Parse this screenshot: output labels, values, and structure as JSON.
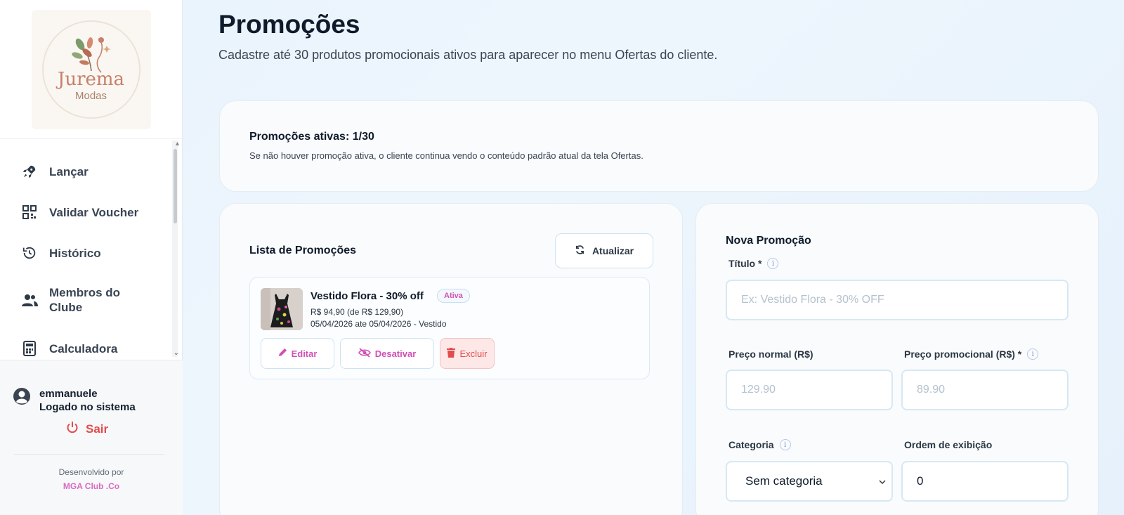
{
  "sidebar": {
    "logo": {
      "title": "Jurema",
      "subtitle": "Modas"
    },
    "items": [
      {
        "label": "Lançar",
        "icon": "rocket-icon"
      },
      {
        "label": "Validar Voucher",
        "icon": "qrcode-icon"
      },
      {
        "label": "Histórico",
        "icon": "history-icon"
      },
      {
        "label": "Membros do Clube",
        "icon": "users-icon"
      },
      {
        "label": "Calculadora",
        "icon": "calculator-icon"
      }
    ],
    "user": {
      "name": "emmanuele",
      "status": "Logado no sistema"
    },
    "logout_label": "Sair",
    "developed_by": "Desenvolvido por",
    "brand": "MGA Club .Co"
  },
  "header": {
    "title": "Promoções",
    "subtitle": "Cadastre até 30 produtos promocionais ativos para aparecer no menu Ofertas do cliente."
  },
  "status": {
    "title": "Promoções ativas: 1/30",
    "subtitle": "Se não houver promoção ativa, o cliente continua vendo o conteúdo padrão atual da tela Ofertas."
  },
  "list": {
    "title": "Lista de Promoções",
    "refresh_label": "Atualizar",
    "items": [
      {
        "name": "Vestido Flora - 30% off",
        "badge": "Ativa",
        "price": "R$ 94,90 (de R$ 129,90)",
        "dates": "05/04/2026 ate 05/04/2026 - Vestido",
        "edit_label": "Editar",
        "disable_label": "Desativar",
        "delete_label": "Excluir"
      }
    ]
  },
  "form": {
    "title": "Nova Promoção",
    "titulo_label": "Título *",
    "titulo_placeholder": "Ex: Vestido Flora - 30% OFF",
    "preco_normal_label": "Preço normal (R$)",
    "preco_normal_placeholder": "129.90",
    "preco_promo_label": "Preço promocional (R$) *",
    "preco_promo_placeholder": "89.90",
    "categoria_label": "Categoria",
    "categoria_value": "Sem categoria",
    "ordem_label": "Ordem de exibição",
    "ordem_value": "0"
  },
  "colors": {
    "accent": "#d14fb6",
    "danger": "#e24b4b",
    "title": "#0f1a2a"
  }
}
